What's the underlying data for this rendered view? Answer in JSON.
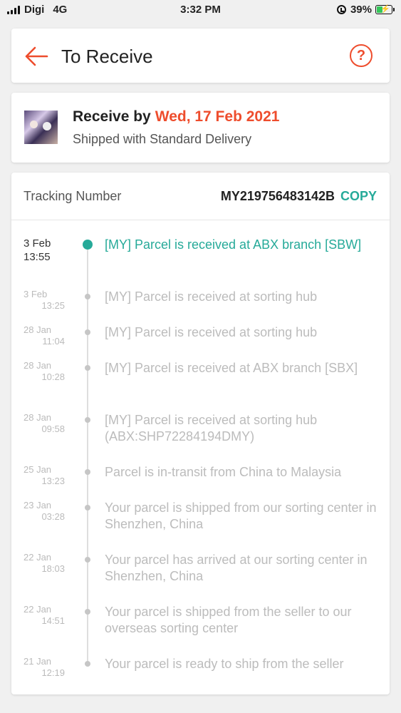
{
  "status_bar": {
    "carrier": "Digi",
    "network": "4G",
    "time": "3:32 PM",
    "battery": "39%",
    "battery_level": 0.39,
    "icons": [
      "signal-icon",
      "orientation-lock-icon",
      "battery-charging-icon"
    ]
  },
  "header": {
    "title": "To Receive",
    "back_icon": "arrow-left-icon",
    "help_icon": "question-circle-icon",
    "help_glyph": "?"
  },
  "delivery": {
    "receive_by_label": "Receive by",
    "receive_date": "Wed, 17 Feb 2021",
    "shipping_method": "Shipped with Standard Delivery"
  },
  "tracking": {
    "label": "Tracking Number",
    "number": "MY219756483142B",
    "copy_label": "COPY",
    "events": [
      {
        "date": "3 Feb",
        "time": "13:55",
        "text": "[MY] Parcel is received at ABX branch [SBW]",
        "active": true
      },
      {
        "date": "3 Feb",
        "time": "13:25",
        "text": "[MY] Parcel is received at sorting hub",
        "active": false
      },
      {
        "date": "28 Jan",
        "time": "11:04",
        "text": "[MY] Parcel is received at sorting hub",
        "active": false
      },
      {
        "date": "28 Jan",
        "time": "10:28",
        "text": "[MY] Parcel is received at ABX branch [SBX]",
        "active": false
      },
      {
        "date": "28 Jan",
        "time": "09:58",
        "text": "[MY] Parcel is received at sorting hub (ABX:SHP72284194DMY)",
        "active": false
      },
      {
        "date": "25 Jan",
        "time": "13:23",
        "text": "Parcel is in-transit from China to Malaysia",
        "active": false
      },
      {
        "date": "23 Jan",
        "time": "03:28",
        "text": "Your parcel is shipped from our sorting center in Shenzhen, China",
        "active": false
      },
      {
        "date": "22 Jan",
        "time": "18:03",
        "text": "Your parcel has arrived at our sorting center in Shenzhen, China",
        "active": false
      },
      {
        "date": "22 Jan",
        "time": "14:51",
        "text": "Your parcel is shipped from the seller to our overseas sorting center",
        "active": false
      },
      {
        "date": "21 Jan",
        "time": "12:19",
        "text": "Your parcel is ready to ship from the seller",
        "active": false
      }
    ]
  },
  "colors": {
    "brand_orange": "#ee4d2d",
    "teal": "#26aa99",
    "muted": "#bcbcbc"
  }
}
